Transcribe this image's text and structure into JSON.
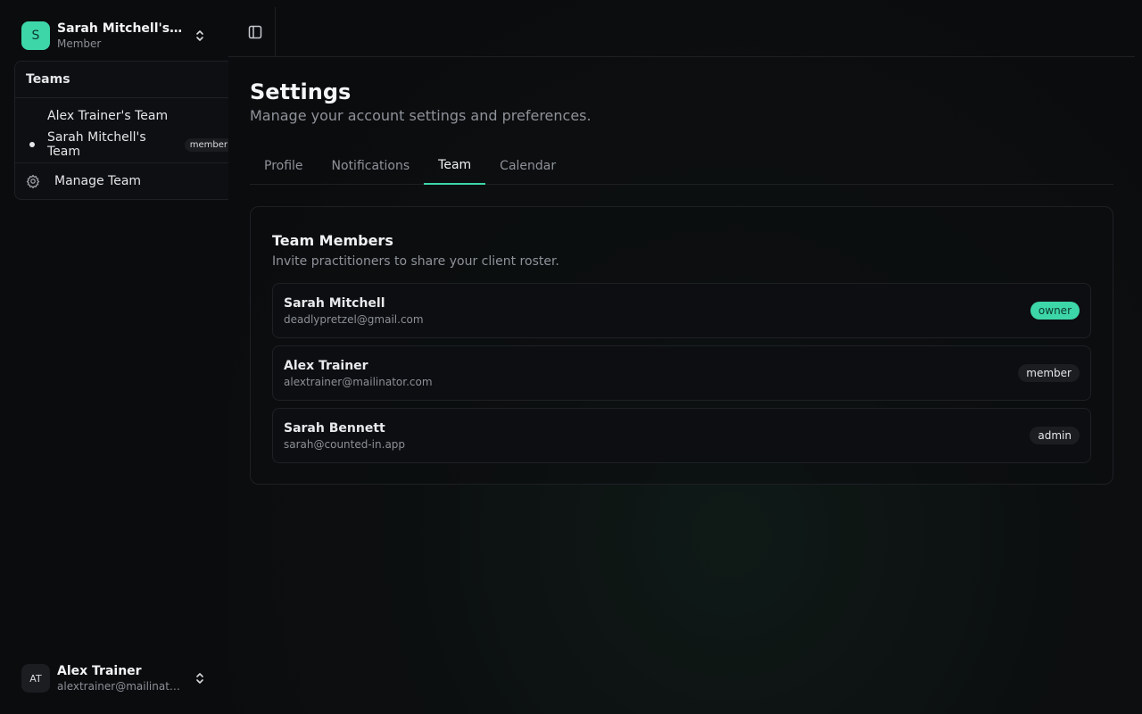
{
  "team_switcher": {
    "avatar_letter": "S",
    "team_name": "Sarah Mitchell's Team",
    "role": "Member",
    "avatar_color": "#3dd6a9"
  },
  "teams_dropdown": {
    "heading": "Teams",
    "teams": [
      {
        "name": "Alex Trainer's Team",
        "selected": false,
        "badge": ""
      },
      {
        "name": "Sarah Mitchell's Team",
        "selected": true,
        "badge": "member"
      }
    ],
    "manage_label": "Manage Team",
    "manage_icon": "gear-icon"
  },
  "user": {
    "initials": "AT",
    "name": "Alex Trainer",
    "email": "alextrainer@mailinator.com"
  },
  "topbar": {
    "toggle_icon": "panel-left-icon"
  },
  "page": {
    "title": "Settings",
    "subtitle": "Manage your account settings and preferences."
  },
  "tabs": [
    {
      "label": "Profile",
      "active": false
    },
    {
      "label": "Notifications",
      "active": false
    },
    {
      "label": "Team",
      "active": true
    },
    {
      "label": "Calendar",
      "active": false
    }
  ],
  "team_card": {
    "title": "Team Members",
    "description": "Invite practitioners to share your client roster.",
    "members": [
      {
        "name": "Sarah Mitchell",
        "email": "deadlypretzel@gmail.com",
        "role": "owner"
      },
      {
        "name": "Alex Trainer",
        "email": "alextrainer@mailinator.com",
        "role": "member"
      },
      {
        "name": "Sarah Bennett",
        "email": "sarah@counted-in.app",
        "role": "admin"
      }
    ]
  },
  "colors": {
    "accent": "#3dd6a9",
    "background": "#0a0b0d",
    "border": "#1e2024"
  }
}
